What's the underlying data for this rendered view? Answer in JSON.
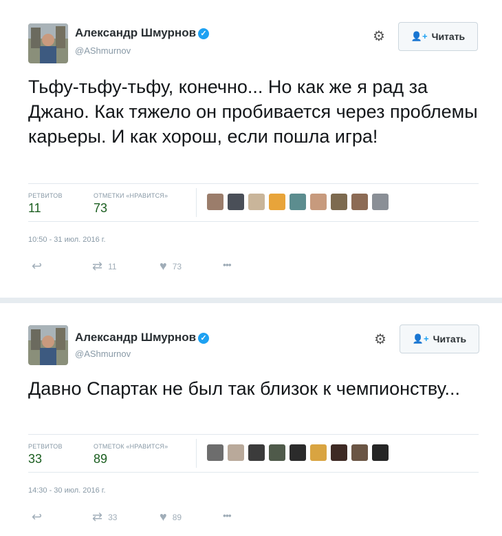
{
  "tweets": [
    {
      "author_name": "Александр Шмурнов",
      "handle": "@AShmurnov",
      "follow_label": "Читать",
      "text": "Тьфу-тьфу-тьфу, конечно... Но как же я рад за Джано. Как тяжело он пробивается через проблемы карьеры. И как хорош, если пошла игра!",
      "retweets_label": "РЕТВИТОВ",
      "retweets": "11",
      "likes_label": "ОТМЕТКИ «НРАВИТСЯ»",
      "likes": "73",
      "timestamp": "10:50 - 31 июл. 2016 г.",
      "action_retweets": "11",
      "action_likes": "73",
      "liker_colors": [
        "#9b7d6b",
        "#4a4f58",
        "#c9b59a",
        "#e8a43a",
        "#5c8d8f",
        "#c79a7d",
        "#7d6a4f",
        "#8c6b55",
        "#8a8f96"
      ]
    },
    {
      "author_name": "Александр Шмурнов",
      "handle": "@AShmurnov",
      "follow_label": "Читать",
      "text": "Давно Спартак не был так близок к чемпионству...",
      "retweets_label": "РЕТВИТОВ",
      "retweets": "33",
      "likes_label": "ОТМЕТОК «НРАВИТСЯ»",
      "likes": "89",
      "timestamp": "14:30 - 30 июл. 2016 г.",
      "action_retweets": "33",
      "action_likes": "89",
      "liker_colors": [
        "#6d6d6d",
        "#b9a99a",
        "#3b3b3b",
        "#4f5a4a",
        "#2b2b2b",
        "#d9a441",
        "#3e2a24",
        "#6a5544",
        "#262626"
      ]
    }
  ]
}
